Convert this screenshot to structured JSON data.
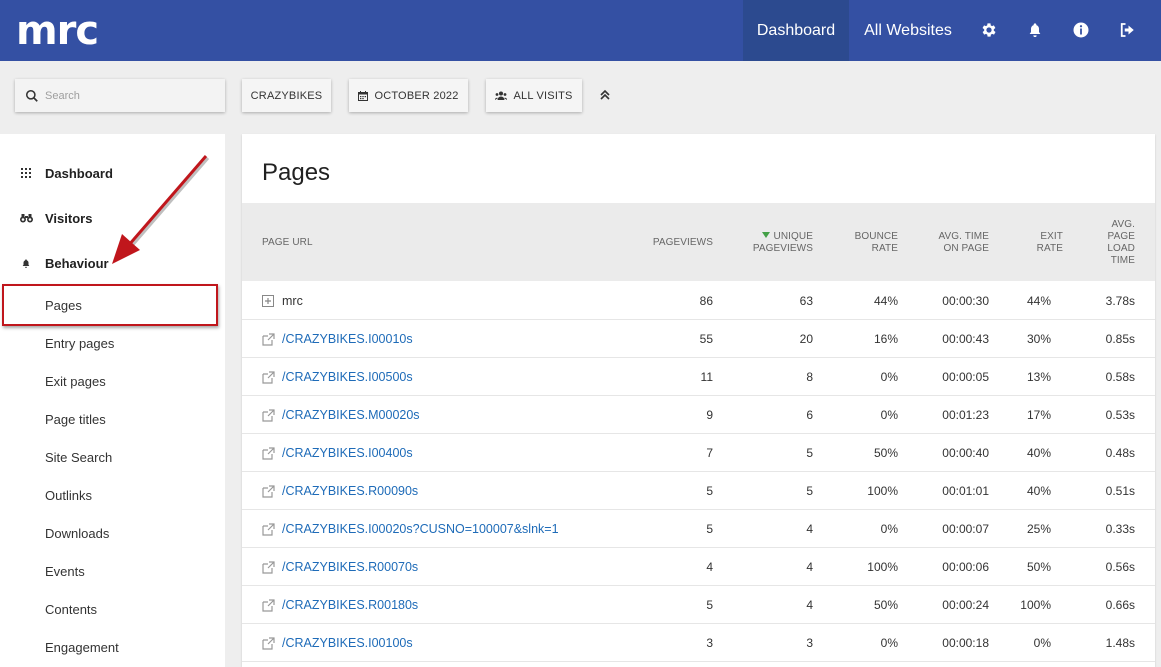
{
  "header": {
    "logo": "mrc",
    "nav": {
      "dashboard": "Dashboard",
      "all_websites": "All Websites"
    },
    "icons": [
      "gear-icon",
      "bell-icon",
      "info-icon",
      "logout-icon"
    ]
  },
  "controls": {
    "search_placeholder": "Search",
    "site": "CRAZYBIKES",
    "period": "OCTOBER 2022",
    "segment": "ALL VISITS"
  },
  "sidebar": {
    "categories": [
      {
        "label": "Dashboard",
        "icon": "grid-icon"
      },
      {
        "label": "Visitors",
        "icon": "binoculars-icon"
      },
      {
        "label": "Behaviour",
        "icon": "bell-icon"
      }
    ],
    "subitems": [
      "Pages",
      "Entry pages",
      "Exit pages",
      "Page titles",
      "Site Search",
      "Outlinks",
      "Downloads",
      "Events",
      "Contents",
      "Engagement"
    ],
    "selected": "Pages"
  },
  "report": {
    "title": "Pages",
    "columns": {
      "url": "PAGE URL",
      "pageviews": "PAGEVIEWS",
      "unique1": "UNIQUE",
      "unique2": "PAGEVIEWS",
      "bounce1": "BOUNCE",
      "bounce2": "RATE",
      "avgtime1": "AVG. TIME",
      "avgtime2": "ON PAGE",
      "exit1": "EXIT",
      "exit2": "RATE",
      "load1": "AVG.",
      "load2": "PAGE",
      "load3": "LOAD",
      "load4": "TIME"
    },
    "sort_color": "#43a047",
    "link_color": "#1e6bb8",
    "rows": [
      {
        "url": "mrc",
        "pageviews": "86",
        "unique": "63",
        "bounce": "44%",
        "avgtime": "00:00:30",
        "exit": "44%",
        "load": "3.78s"
      },
      {
        "url": "/CRAZYBIKES.I00010s",
        "pageviews": "55",
        "unique": "20",
        "bounce": "16%",
        "avgtime": "00:00:43",
        "exit": "30%",
        "load": "0.85s"
      },
      {
        "url": "/CRAZYBIKES.I00500s",
        "pageviews": "11",
        "unique": "8",
        "bounce": "0%",
        "avgtime": "00:00:05",
        "exit": "13%",
        "load": "0.58s"
      },
      {
        "url": "/CRAZYBIKES.M00020s",
        "pageviews": "9",
        "unique": "6",
        "bounce": "0%",
        "avgtime": "00:01:23",
        "exit": "17%",
        "load": "0.53s"
      },
      {
        "url": "/CRAZYBIKES.I00400s",
        "pageviews": "7",
        "unique": "5",
        "bounce": "50%",
        "avgtime": "00:00:40",
        "exit": "40%",
        "load": "0.48s"
      },
      {
        "url": "/CRAZYBIKES.R00090s",
        "pageviews": "5",
        "unique": "5",
        "bounce": "100%",
        "avgtime": "00:01:01",
        "exit": "40%",
        "load": "0.51s"
      },
      {
        "url": "/CRAZYBIKES.I00020s?CUSNO=100007&slnk=1",
        "pageviews": "5",
        "unique": "4",
        "bounce": "0%",
        "avgtime": "00:00:07",
        "exit": "25%",
        "load": "0.33s"
      },
      {
        "url": "/CRAZYBIKES.R00070s",
        "pageviews": "4",
        "unique": "4",
        "bounce": "100%",
        "avgtime": "00:00:06",
        "exit": "50%",
        "load": "0.56s"
      },
      {
        "url": "/CRAZYBIKES.R00180s",
        "pageviews": "5",
        "unique": "4",
        "bounce": "50%",
        "avgtime": "00:00:24",
        "exit": "100%",
        "load": "0.66s"
      },
      {
        "url": "/CRAZYBIKES.I00100s",
        "pageviews": "3",
        "unique": "3",
        "bounce": "0%",
        "avgtime": "00:00:18",
        "exit": "0%",
        "load": "1.48s"
      }
    ]
  }
}
